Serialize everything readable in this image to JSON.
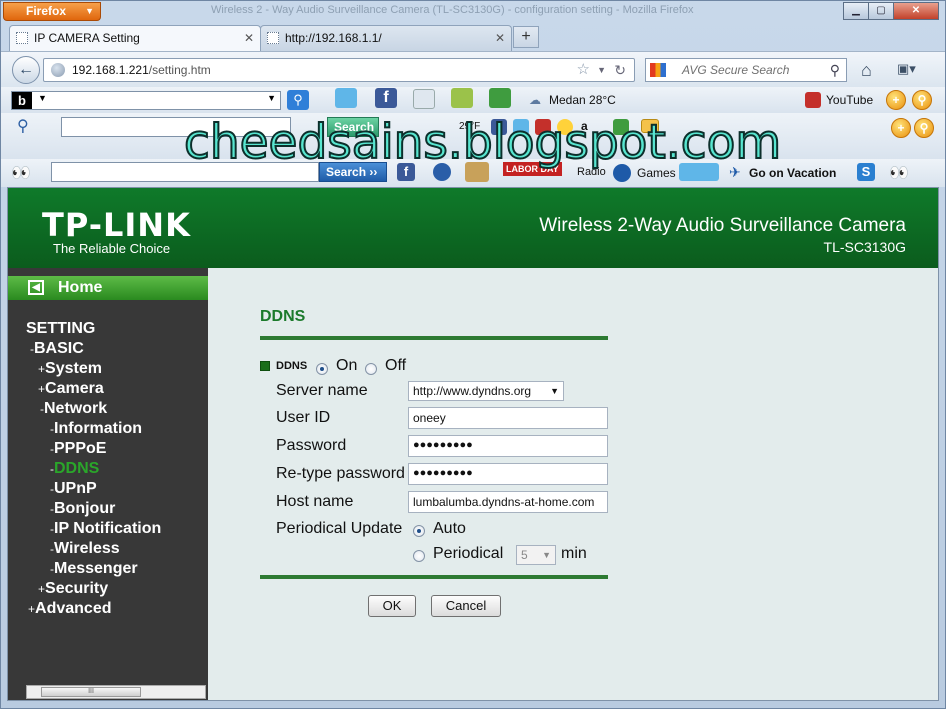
{
  "browser": {
    "app_button": "Firefox",
    "title": "Wireless 2 - Way Audio Surveillance Camera (TL-SC3130G) - configuration setting - Mozilla Firefox",
    "tabs": [
      {
        "label": "IP CAMERA Setting",
        "active": true
      },
      {
        "label": "http://192.168.1.1/",
        "active": false
      }
    ],
    "url_host": "192.168.1.221",
    "url_path": "/setting.htm",
    "search_placeholder": "AVG Secure Search"
  },
  "toolbars": {
    "weather": "Medan 28°C",
    "youtube": "YouTube",
    "search_btn1": "Search",
    "search_btn2": "Search ››",
    "radio": "Radio",
    "games": "Games",
    "vacation": "Go on Vacation",
    "labor_day": "LABOR DAY",
    "temp_small": "29°F"
  },
  "watermark": "cheedsains.blogspot.com",
  "header": {
    "logo": "TP-LINK",
    "tagline": "The Reliable Choice",
    "product": "Wireless 2-Way Audio Surveillance Camera",
    "model": "TL-SC3130G"
  },
  "sidebar": {
    "home": "Home",
    "items": [
      {
        "pre": "",
        "label": "SETTING"
      },
      {
        "pre": "-",
        "label": "BASIC"
      },
      {
        "pre": "+",
        "label": "System"
      },
      {
        "pre": "+",
        "label": "Camera"
      },
      {
        "pre": "-",
        "label": "Network"
      },
      {
        "pre": "-",
        "label": "Information"
      },
      {
        "pre": "-",
        "label": "PPPoE"
      },
      {
        "pre": "-",
        "label": "DDNS"
      },
      {
        "pre": "-",
        "label": "UPnP"
      },
      {
        "pre": "-",
        "label": "Bonjour"
      },
      {
        "pre": "-",
        "label": "IP Notification"
      },
      {
        "pre": "-",
        "label": "Wireless"
      },
      {
        "pre": "-",
        "label": "Messenger"
      },
      {
        "pre": "+",
        "label": "Security"
      },
      {
        "pre": "+",
        "label": "Advanced"
      }
    ],
    "scroll_grip": "III"
  },
  "form": {
    "title": "DDNS",
    "ddns_label": "DDNS",
    "on_label": "On",
    "off_label": "Off",
    "ddns_enabled": true,
    "server_name_label": "Server name",
    "server_name_value": "http://www.dyndns.org",
    "user_id_label": "User ID",
    "user_id_value": "oneey",
    "password_label": "Password",
    "password_value": "●●●●●●●●●",
    "retype_label": "Re-type password",
    "retype_value": "●●●●●●●●●",
    "host_label": "Host name",
    "host_value": "lumbalumba.dyndns-at-home.com",
    "periodic_label": "Periodical Update",
    "auto_label": "Auto",
    "periodical_label": "Periodical",
    "periodical_value": "5",
    "min_label": "min",
    "update_mode": "auto",
    "ok": "OK",
    "cancel": "Cancel"
  },
  "colors": {
    "header_green": "#0f7a2a",
    "active_menu": "#2aa62a",
    "sidebar_bg": "#383838",
    "title_green": "#1b7a2b"
  }
}
